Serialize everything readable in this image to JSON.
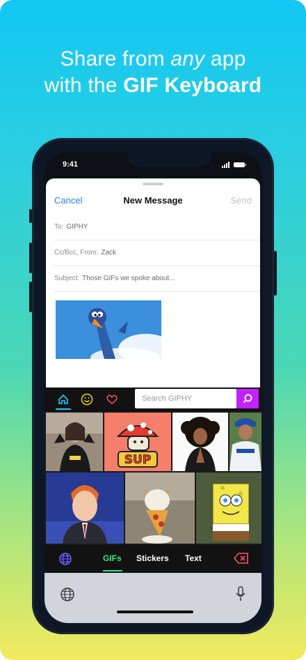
{
  "headline": {
    "line1_prefix": "Share from ",
    "line1_em": "any",
    "line1_suffix": " app",
    "line2_prefix": "with the ",
    "line2_strong": "GIF Keyboard"
  },
  "status_bar": {
    "time": "9:41"
  },
  "mail": {
    "cancel": "Cancel",
    "title": "New Message",
    "send": "Send",
    "to_label": "To:",
    "to_value": "GIPHY",
    "cc_label": "Cc/Bcc, From:",
    "cc_value": "Zack",
    "subject_label": "Subject:",
    "subject_value": "Those GIFs we spoke about..."
  },
  "giphy": {
    "search_placeholder": "Search GIPHY",
    "tabs": [
      "home-icon",
      "smiley-icon",
      "heart-icon"
    ],
    "bottom": {
      "gifs": "GIFs",
      "stickers": "Stickers",
      "text": "Text"
    },
    "tile_text_sup": "SUP",
    "colors": {
      "accent_cyan": "#17d0ff",
      "search_purple": "#c222ff",
      "active_green": "#37e28a",
      "delete_red": "#ff4d6d"
    }
  }
}
